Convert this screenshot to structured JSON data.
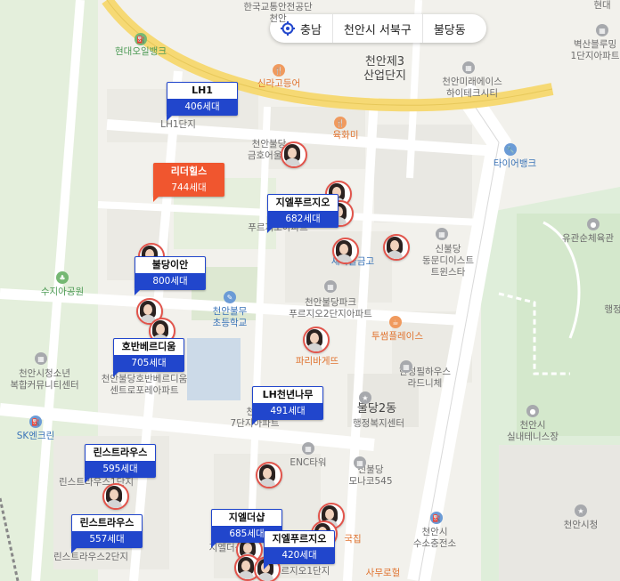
{
  "region_bar": {
    "province": "충남",
    "city": "천안시 서북구",
    "district": "불당동"
  },
  "markers": [
    {
      "name": "LH1",
      "count": "406세대",
      "highlight": false
    },
    {
      "name": "리더힐스",
      "count": "744세대",
      "highlight": true
    },
    {
      "name": "지엘푸르지오",
      "count": "682세대",
      "highlight": false
    },
    {
      "name": "불당이안",
      "count": "800세대",
      "highlight": false
    },
    {
      "name": "호반베르디움",
      "count": "705세대",
      "highlight": false
    },
    {
      "name": "LH천년나무",
      "count": "491세대",
      "highlight": false
    },
    {
      "name": "린스트라우스",
      "count": "595세대",
      "highlight": false
    },
    {
      "name": "린스트라우스",
      "count": "557세대",
      "highlight": false
    },
    {
      "name": "지엘더샵",
      "count": "685세대",
      "highlight": false
    },
    {
      "name": "지엘푸르지오",
      "count": "420세대",
      "highlight": false
    }
  ],
  "labels": {
    "kotsa": "한국교통안전공단",
    "kotsa2": "천안",
    "hyundai_oil": "현대오일뱅크",
    "sinra": "신라고등어",
    "industrial": "천안제3",
    "industrial2": "산업단지",
    "mirae": "천안미래에이스",
    "mirae2": "하이테크시티",
    "byeoksan": "벽산블루밍",
    "byeoksan2": "1단지아파트",
    "yukhwami": "육화미",
    "tire": "타이어뱅크",
    "lh1_complex": "LH1단지",
    "geumho": "천안불당",
    "geumho2": "금호어울림",
    "puruji_complex": "푸르지오아파트",
    "saema": "새마을금고",
    "sinbuldang": "신불당",
    "sinbuldang2": "동문디이스트",
    "sinbuldang3": "트윈스타",
    "ugwan": "유관순체육관",
    "haengjeong": "행정",
    "suji": "수지아공원",
    "buldang_elem": "천안불무",
    "buldang_elem2": "초등학교",
    "buldang_park": "천안불당파크",
    "buldang_park2": "푸르지오2단지아파트",
    "twosome": "투썸플레이스",
    "paris": "파리바게뜨",
    "hansung": "한성필하우스",
    "hansung2": "라드니체",
    "hoban_apt": "천안불당호반베르디움",
    "hoban_apt2": "센트로포레아파트",
    "youth": "천안시청소년",
    "youth2": "복합커뮤니티센터",
    "sk": "SK엔크린",
    "lh7": "천안",
    "lh7b": "7단지아파트",
    "buldang2": "불당2동",
    "buldang2b": "행정복지센터",
    "enc": "ENC타워",
    "tennis": "천안시",
    "tennis2": "실내테니스장",
    "sinbuldang_monacco": "신불당",
    "sinbuldang_monacco2": "모나코545",
    "rinstra1": "린스트라우스1단지",
    "rinstra2": "린스트라우스2단지",
    "hydrogen": "천안시",
    "hydrogen2": "수소충전소",
    "cityhall": "천안시청",
    "jiel_the": "지엘더샵",
    "jiel_puruji1": "푸르지오1단지",
    "gukjip": "국집",
    "sangdo": "사무로헐",
    "hyundai_top": "현대"
  }
}
